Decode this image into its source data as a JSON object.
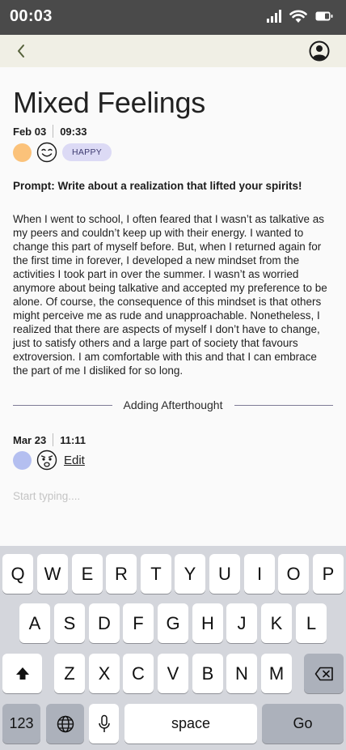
{
  "status_bar": {
    "time": "00:03",
    "icons": [
      "cellular-icon",
      "wifi-icon",
      "battery-icon"
    ]
  },
  "nav": {
    "back_icon": "chevron-left-icon",
    "profile_icon": "user-circle-icon"
  },
  "entry": {
    "title": "Mixed Feelings",
    "date": "Feb 03",
    "time": "09:33",
    "mood_color": "#fbc27a",
    "mood_face": "smiling-face-icon",
    "mood_label": "HAPPY",
    "prompt": "Prompt: Write about a realization that lifted your spirits!",
    "body": "When I went to school, I often feared that I wasn’t as talkative as my peers and couldn’t keep up with their energy. I wanted to change this part of myself before. But, when I returned again for the first time in forever, I developed a new mindset from the activities I took part in over the summer. I wasn’t as worried anymore about being talkative and accepted my preference to be alone. Of course, the consequence of this mindset is that others might perceive me as rude and unapproachable. Nonetheless, I realized that there are aspects of myself I don’t have to change, just to satisfy others and a large part of society that favours extroversion. I am comfortable with this and that I can embrace the part of me I disliked for so long."
  },
  "afterthought": {
    "divider_label": "Adding Afterthought",
    "date": "Mar 23",
    "time": "11:11",
    "mood_color": "#b4bff0",
    "mood_face": "worried-face-icon",
    "edit_label": "Edit",
    "input_placeholder": "Start typing....",
    "input_value": ""
  },
  "keyboard": {
    "row1": [
      "Q",
      "W",
      "E",
      "R",
      "T",
      "Y",
      "U",
      "I",
      "O",
      "P"
    ],
    "row2": [
      "A",
      "S",
      "D",
      "F",
      "G",
      "H",
      "J",
      "K",
      "L"
    ],
    "row3": [
      "Z",
      "X",
      "C",
      "V",
      "B",
      "N",
      "M"
    ],
    "shift_icon": "shift-icon",
    "backspace_icon": "backspace-icon",
    "numbers_label": "123",
    "globe_icon": "globe-icon",
    "mic_icon": "microphone-icon",
    "space_label": "space",
    "go_label": "Go"
  },
  "colors": {
    "status_bar": "#4a4a4a",
    "nav_bar": "#f0efe5",
    "badge": "#dcdaf5",
    "keyboard_bg": "#d4d6dc"
  }
}
